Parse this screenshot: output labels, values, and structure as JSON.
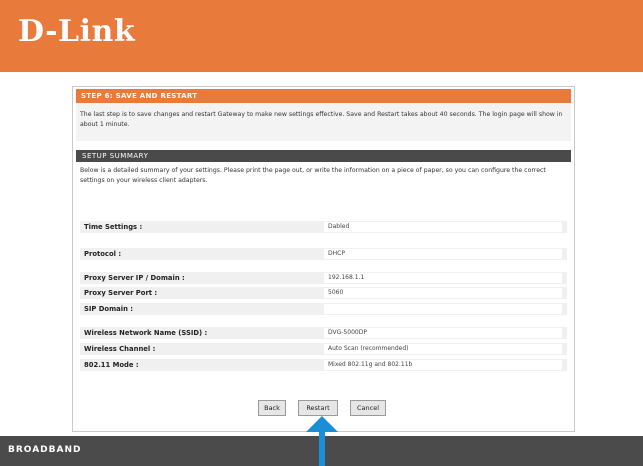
{
  "header": {
    "logo_text": "D-Link"
  },
  "step": {
    "title": "STEP 6: SAVE AND RESTART",
    "description": "The last step is to save changes and restart Gateway to make new settings effective. Save and Restart takes about 40 seconds. The login page will show in about 1 minute."
  },
  "summary": {
    "title": "SETUP SUMMARY",
    "description": "Below is a detailed summary of your settings. Please print the page out, or write the information on a piece of paper, so you can configure the correct settings on your wireless client adapters.",
    "rows": [
      {
        "label": "Time Settings :",
        "value": "Dabled"
      },
      {
        "label": "Protocol :",
        "value": "DHCP"
      },
      {
        "label": "Proxy Server IP / Domain :",
        "value": "192.168.1.1"
      },
      {
        "label": "Proxy Server Port :",
        "value": "5060"
      },
      {
        "label": "SIP Domain :",
        "value": ""
      },
      {
        "label": "Wireless Network Name (SSID) :",
        "value": "DVG-5000DP"
      },
      {
        "label": "Wireless Channel :",
        "value": "Auto Scan (recommended)"
      },
      {
        "label": "802.11 Mode :",
        "value": "Mixed 802.11g and 802.11b"
      }
    ]
  },
  "buttons": {
    "back": "Back",
    "restart": "Restart",
    "cancel": "Cancel"
  },
  "footer": {
    "brand": "BROADBAND"
  },
  "annotation": {
    "arrow_color": "#1a8fd8",
    "arrow_icon": "arrow-up-icon"
  },
  "colors": {
    "brand_orange": "#e87a3c",
    "dark_bar": "#4a4a4a"
  }
}
